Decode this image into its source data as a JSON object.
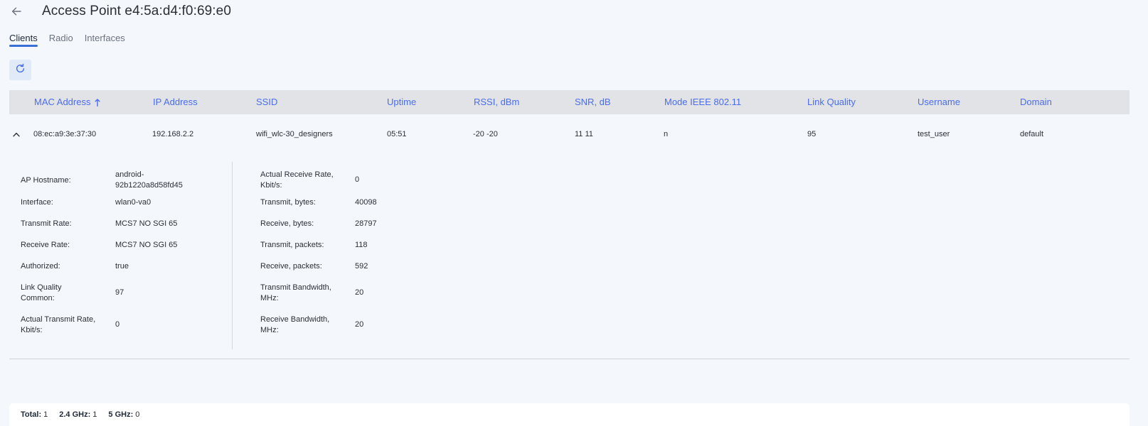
{
  "header": {
    "title": "Access Point e4:5a:d4:f0:69:e0"
  },
  "tabs": [
    {
      "label": "Clients",
      "active": true
    },
    {
      "label": "Radio",
      "active": false
    },
    {
      "label": "Interfaces",
      "active": false
    }
  ],
  "colors": {
    "accent": "#4a6cf0",
    "tab_underline": "#3a6fd8",
    "table_header_bg": "#e2e3e6",
    "page_bg": "#f4f7fc",
    "refresh_bg": "#e1eaf9"
  },
  "table": {
    "columns": [
      {
        "label": "MAC Address",
        "sorted": "ascending"
      },
      {
        "label": "IP Address"
      },
      {
        "label": "SSID"
      },
      {
        "label": "Uptime"
      },
      {
        "label": "RSSI, dBm"
      },
      {
        "label": "SNR, dB"
      },
      {
        "label": "Mode IEEE 802.11"
      },
      {
        "label": "Link Quality"
      },
      {
        "label": "Username"
      },
      {
        "label": "Domain"
      }
    ],
    "rows": [
      {
        "mac": "08:ec:a9:3e:37:30",
        "ip": "192.168.2.2",
        "ssid": "wifi_wlc-30_designers",
        "uptime": "05:51",
        "rssi": "-20 -20",
        "snr": "11 11",
        "mode": "n",
        "link_quality": "95",
        "username": "test_user",
        "domain": "default"
      }
    ]
  },
  "details": {
    "left": [
      {
        "label": "AP Hostname:",
        "value": "android-\n92b1220a8d58fd45"
      },
      {
        "label": "Interface:",
        "value": "wlan0-va0"
      },
      {
        "label": "Transmit Rate:",
        "value": "MCS7 NO SGI 65"
      },
      {
        "label": "Receive Rate:",
        "value": "MCS7 NO SGI 65"
      },
      {
        "label": "Authorized:",
        "value": "true"
      },
      {
        "label": "Link Quality\nCommon:",
        "value": "97"
      },
      {
        "label": "Actual Transmit Rate,\nKbit/s:",
        "value": "0"
      }
    ],
    "right": [
      {
        "label": "Actual Receive Rate,\nKbit/s:",
        "value": "0"
      },
      {
        "label": "Transmit, bytes:",
        "value": "40098"
      },
      {
        "label": "Receive, bytes:",
        "value": "28797"
      },
      {
        "label": "Transmit, packets:",
        "value": "118"
      },
      {
        "label": "Receive, packets:",
        "value": "592"
      },
      {
        "label": "Transmit Bandwidth,\nMHz:",
        "value": "20"
      },
      {
        "label": "Receive Bandwidth,\nMHz:",
        "value": "20"
      }
    ]
  },
  "footer": {
    "stats": [
      {
        "label": "Total:",
        "value": "1"
      },
      {
        "label": "2.4 GHz:",
        "value": "1"
      },
      {
        "label": "5 GHz:",
        "value": "0"
      }
    ]
  }
}
